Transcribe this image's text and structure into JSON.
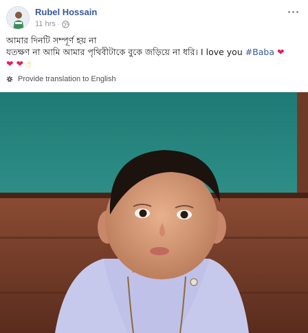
{
  "post": {
    "author_name": "Rubel Hossain",
    "timestamp": "11 hrs",
    "separator": "·",
    "privacy_icon": "globe-icon",
    "text_line1": "আমার দিনটি সম্পূর্ণ হয় না",
    "text_line2_main": "যতক্ষণ না আমি আমার পৃথিবীটাকে বুকে জড়িয়ে না ধরি। I love you ",
    "hashtag": "#Baba",
    "emoji_heart": "❤",
    "emoji_hand": "☝"
  },
  "translation": {
    "label": "Provide translation to English",
    "icon": "gear-icon"
  },
  "photo": {
    "subject": "child-photo"
  },
  "colors": {
    "link_blue": "#365899",
    "meta_gray": "#90949c",
    "heart_red": "#e0245e"
  }
}
